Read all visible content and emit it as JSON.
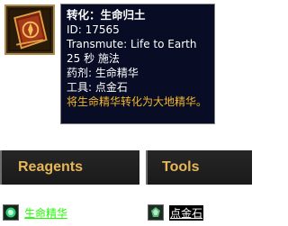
{
  "spell": {
    "icon": "transmute-book-icon",
    "title": "转化：生命归土",
    "id_line": "ID: 17565",
    "english_name": "Transmute: Life to Earth",
    "cast": "25 秒 施法",
    "reagent_line": "药剂: 生命精华",
    "tool_line": "工具: 点金石",
    "description": "将生命精华转化为大地精华。"
  },
  "sections": {
    "reagents_label": "Reagents",
    "tools_label": "Tools"
  },
  "reagents": [
    {
      "name": "生命精华",
      "icon": "essence-of-life-icon",
      "quality_color": "#1eff00"
    }
  ],
  "tools": [
    {
      "name": "点金石",
      "icon": "philosophers-stone-icon"
    }
  ],
  "colors": {
    "tooltip_bg": "#080c24",
    "description": "#f5b928",
    "section_label": "#e6b756",
    "uncommon": "#1eff00"
  }
}
